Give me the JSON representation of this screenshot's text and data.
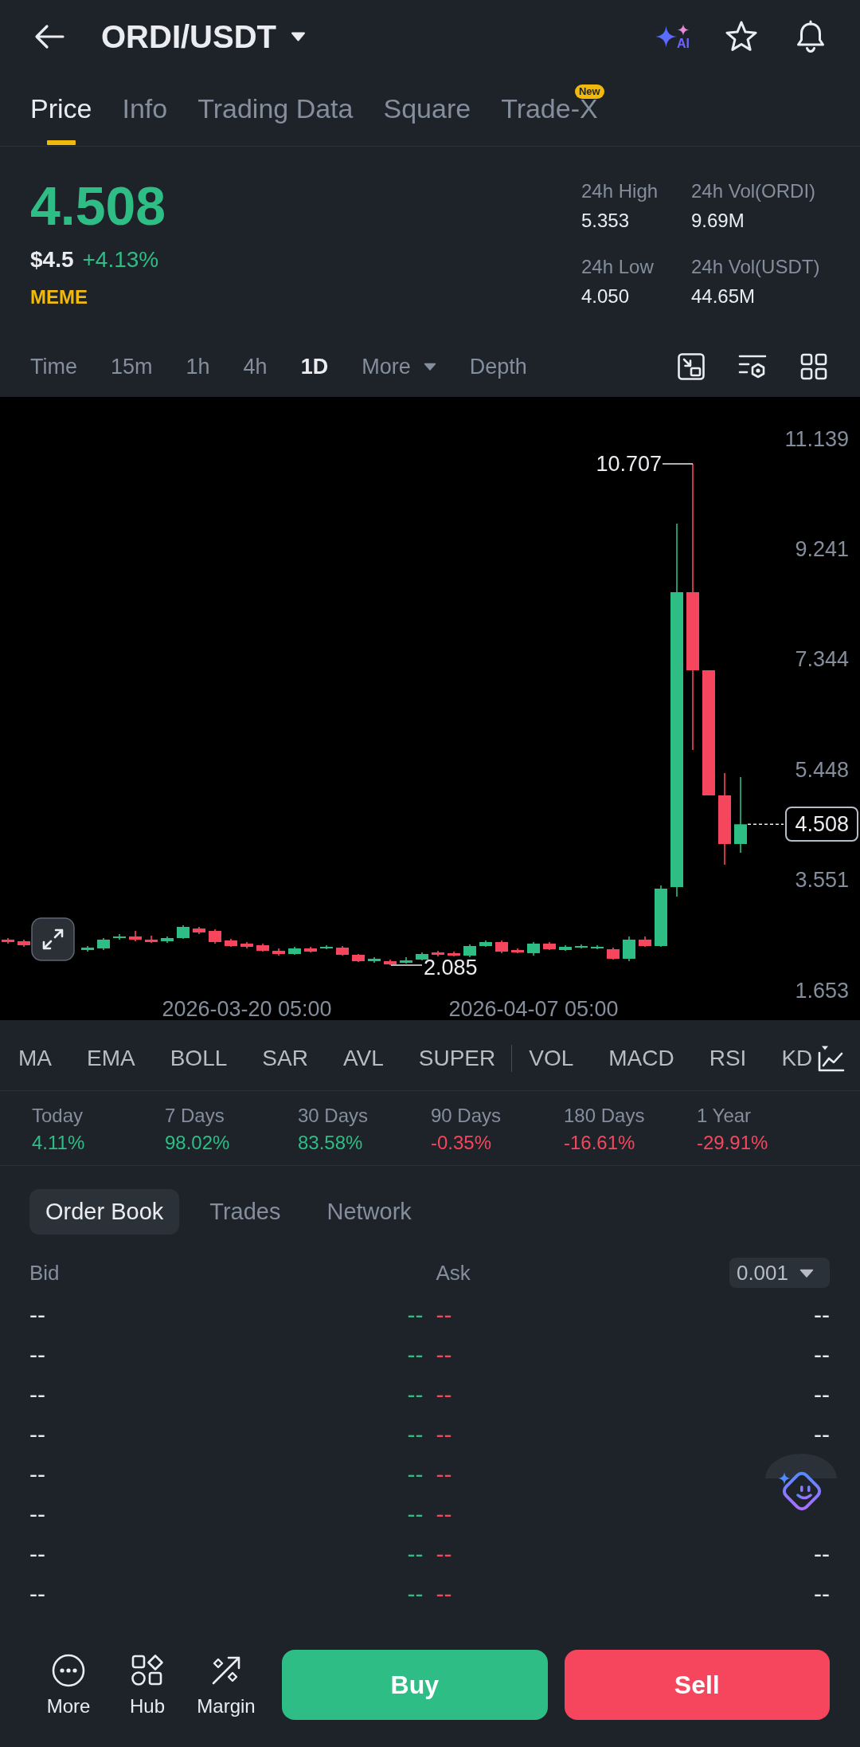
{
  "header": {
    "title": "ORDI/USDT",
    "ai_label": "AI"
  },
  "tabs": [
    {
      "label": "Price",
      "selected": true
    },
    {
      "label": "Info",
      "selected": false
    },
    {
      "label": "Trading Data",
      "selected": false
    },
    {
      "label": "Square",
      "selected": false
    },
    {
      "label": "Trade-X",
      "selected": false,
      "badge": "New"
    }
  ],
  "ticker": {
    "last_price": "4.508",
    "positive": true,
    "usd_price": "$4.5",
    "change": "+4.13%",
    "category": "MEME",
    "stats": [
      {
        "label": "24h High",
        "value": "5.353"
      },
      {
        "label": "24h Vol(ORDI)",
        "value": "9.69M"
      },
      {
        "label": "24h Low",
        "value": "4.050"
      },
      {
        "label": "24h Vol(USDT)",
        "value": "44.65M"
      }
    ]
  },
  "intervals": [
    {
      "label": "Time",
      "kind": "option",
      "selected": false
    },
    {
      "label": "15m",
      "kind": "option",
      "selected": false
    },
    {
      "label": "1h",
      "kind": "option",
      "selected": false
    },
    {
      "label": "4h",
      "kind": "option",
      "selected": false
    },
    {
      "label": "1D",
      "kind": "option",
      "selected": true
    },
    {
      "label": "More",
      "kind": "dropdown",
      "selected": false
    },
    {
      "label": "Depth",
      "kind": "option",
      "selected": false
    }
  ],
  "chart": {
    "chart_data": {
      "type": "candlestick",
      "categories": [
        null,
        null,
        null,
        null,
        null,
        null,
        null,
        null,
        null,
        null,
        null,
        null,
        null,
        null,
        null,
        "2026-03-20 05:00",
        null,
        null,
        null,
        null,
        null,
        null,
        null,
        null,
        null,
        null,
        null,
        null,
        null,
        null,
        null,
        null,
        null,
        "2026-04-07 05:00",
        null,
        null,
        null,
        null,
        null,
        null,
        null,
        null,
        null,
        null,
        null,
        null,
        null
      ],
      "ohlc": [
        [
          2.524,
          2.551,
          2.455,
          2.482
        ],
        [
          2.496,
          2.524,
          2.4,
          2.428
        ],
        null,
        null,
        null,
        [
          2.345,
          2.414,
          2.318,
          2.387
        ],
        [
          2.373,
          2.551,
          2.345,
          2.524
        ],
        [
          2.551,
          2.62,
          2.524,
          2.578
        ],
        [
          2.578,
          2.674,
          2.496,
          2.524
        ],
        [
          2.524,
          2.592,
          2.469,
          2.482
        ],
        [
          2.496,
          2.578,
          2.469,
          2.551
        ],
        [
          2.551,
          2.77,
          2.537,
          2.743
        ],
        [
          2.715,
          2.743,
          2.62,
          2.647
        ],
        [
          2.674,
          2.702,
          2.455,
          2.482
        ],
        [
          2.51,
          2.537,
          2.4,
          2.414
        ],
        [
          2.455,
          2.482,
          2.373,
          2.4
        ],
        [
          2.428,
          2.455,
          2.318,
          2.332
        ],
        [
          2.332,
          2.373,
          2.249,
          2.277
        ],
        [
          2.277,
          2.4,
          2.263,
          2.373
        ],
        [
          2.373,
          2.4,
          2.304,
          2.318
        ],
        [
          2.373,
          2.428,
          2.359,
          2.4
        ],
        [
          2.387,
          2.414,
          2.249,
          2.263
        ],
        [
          2.263,
          2.277,
          2.14,
          2.153
        ],
        [
          2.153,
          2.222,
          2.126,
          2.195
        ],
        [
          2.153,
          2.181,
          2.085,
          2.099
        ],
        [
          2.126,
          2.222,
          2.112,
          2.167
        ],
        [
          2.181,
          2.304,
          2.167,
          2.277
        ],
        [
          2.304,
          2.332,
          2.236,
          2.263
        ],
        [
          2.291,
          2.318,
          2.236,
          2.249
        ],
        [
          2.249,
          2.441,
          2.222,
          2.414
        ],
        [
          2.414,
          2.51,
          2.4,
          2.482
        ],
        [
          2.482,
          2.51,
          2.291,
          2.318
        ],
        [
          2.345,
          2.373,
          2.291,
          2.304
        ],
        [
          2.291,
          2.482,
          2.249,
          2.455
        ],
        [
          2.455,
          2.482,
          2.345,
          2.359
        ],
        [
          2.345,
          2.428,
          2.332,
          2.4
        ],
        [
          2.387,
          2.441,
          2.373,
          2.414
        ],
        [
          2.373,
          2.428,
          2.359,
          2.4
        ],
        [
          2.359,
          2.387,
          2.181,
          2.195
        ],
        [
          2.195,
          2.578,
          2.153,
          2.524
        ],
        [
          2.524,
          2.578,
          2.4,
          2.414
        ],
        [
          2.414,
          3.456,
          2.4,
          3.401
        ],
        [
          3.428,
          9.679,
          3.264,
          8.5
        ],
        [
          8.5,
          10.707,
          5.786,
          7.157
        ],
        [
          7.157,
          7.157,
          5.005,
          5.005
        ],
        [
          5.005,
          5.389,
          3.812,
          4.169
        ],
        [
          4.169,
          5.32,
          4.018,
          4.508
        ]
      ],
      "ylim": [
        1.139,
        11.859
      ],
      "yticks": [
        11.139,
        9.241,
        7.344,
        5.448,
        3.551,
        1.653
      ],
      "annotations": [
        "10.707",
        "2.085"
      ]
    },
    "last_price_tag": "4.508"
  },
  "indicators": {
    "main": [
      "MA",
      "EMA",
      "BOLL",
      "SAR",
      "AVL",
      "SUPER"
    ],
    "sub": [
      "VOL",
      "MACD",
      "RSI",
      "KD"
    ]
  },
  "performance": [
    {
      "label": "Today",
      "value": "4.11%",
      "positive": true
    },
    {
      "label": "7 Days",
      "value": "98.02%",
      "positive": true
    },
    {
      "label": "30 Days",
      "value": "83.58%",
      "positive": true
    },
    {
      "label": "90 Days",
      "value": "-0.35%",
      "positive": false
    },
    {
      "label": "180 Days",
      "value": "-16.61%",
      "positive": false
    },
    {
      "label": "1 Year",
      "value": "-29.91%",
      "positive": false
    }
  ],
  "order_book": {
    "tabs": [
      {
        "label": "Order Book",
        "selected": true
      },
      {
        "label": "Trades",
        "selected": false
      },
      {
        "label": "Network",
        "selected": false
      }
    ],
    "bid_header": "Bid",
    "ask_header": "Ask",
    "precision": "0.001",
    "rows": [
      {
        "bid_amount": "--",
        "bid_price": "--",
        "ask_price": "--",
        "ask_amount": "--"
      },
      {
        "bid_amount": "--",
        "bid_price": "--",
        "ask_price": "--",
        "ask_amount": "--"
      },
      {
        "bid_amount": "--",
        "bid_price": "--",
        "ask_price": "--",
        "ask_amount": "--"
      },
      {
        "bid_amount": "--",
        "bid_price": "--",
        "ask_price": "--",
        "ask_amount": "--"
      },
      {
        "bid_amount": "--",
        "bid_price": "--",
        "ask_price": "--"
      },
      {
        "bid_amount": "--",
        "bid_price": "--",
        "ask_price": "--"
      },
      {
        "bid_amount": "--",
        "bid_price": "--",
        "ask_price": "--",
        "ask_amount": "--"
      },
      {
        "bid_amount": "--",
        "bid_price": "--",
        "ask_price": "--",
        "ask_amount": "--"
      }
    ]
  },
  "bottom_bar": {
    "actions": [
      {
        "label": "More",
        "kind": "more"
      },
      {
        "label": "Hub",
        "kind": "hub"
      },
      {
        "label": "Margin",
        "kind": "margin"
      }
    ],
    "buy_label": "Buy",
    "sell_label": "Sell"
  }
}
